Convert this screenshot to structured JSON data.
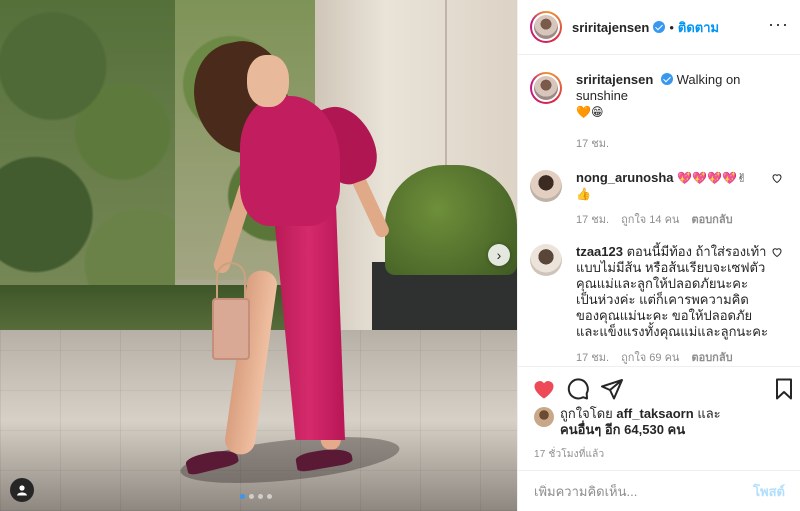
{
  "post_author": {
    "username": "sriritajensen",
    "separator": "•",
    "follow_label": "ติดตาม",
    "more_label": "···"
  },
  "caption": {
    "username": "sriritajensen",
    "text": "Walking on sunshine",
    "emojis": "🧡😁",
    "time": "17 ชม."
  },
  "comments": [
    {
      "username": "nong_arunosha",
      "text": "💖💖💖💖✌",
      "text2": "👍",
      "time": "17 ชม.",
      "likes": "ถูกใจ 14 คน",
      "reply": "ตอบกลับ"
    },
    {
      "username": "tzaa123",
      "text": "ตอนนี้มีท้อง ถ้าใส่รองเท้าแบบไม่มีส้น หรือส้นเรียบจะเซฟตัวคุณแม่และลูกให้ปลอดภัยนะคะ เป็นห่วงค่ะ แต่ก็เคารพความคิดของคุณแม่นะคะ ขอให้ปลอดภัยและแข็งแรงทั้งคุณแม่และลูกนะคะ",
      "time": "17 ชม.",
      "likes": "ถูกใจ 69 คน",
      "reply": "ตอบกลับ"
    }
  ],
  "likes": {
    "prefix": "ถูกใจโดย",
    "user": "aff_taksaorn",
    "and": "และ",
    "others_label": "คนอื่นๆ อีก 64,530 คน"
  },
  "timestamp": "17 ชั่วโมงที่แล้ว",
  "composer": {
    "placeholder": "เพิ่มความคิดเห็น...",
    "post_label": "โพสต์"
  },
  "carousel": {
    "next_label": "›",
    "dot_count": 4,
    "active_index": 0
  },
  "colors": {
    "accent": "#0095f6",
    "like_red": "#ed4956",
    "dress": "#c21d5e"
  }
}
